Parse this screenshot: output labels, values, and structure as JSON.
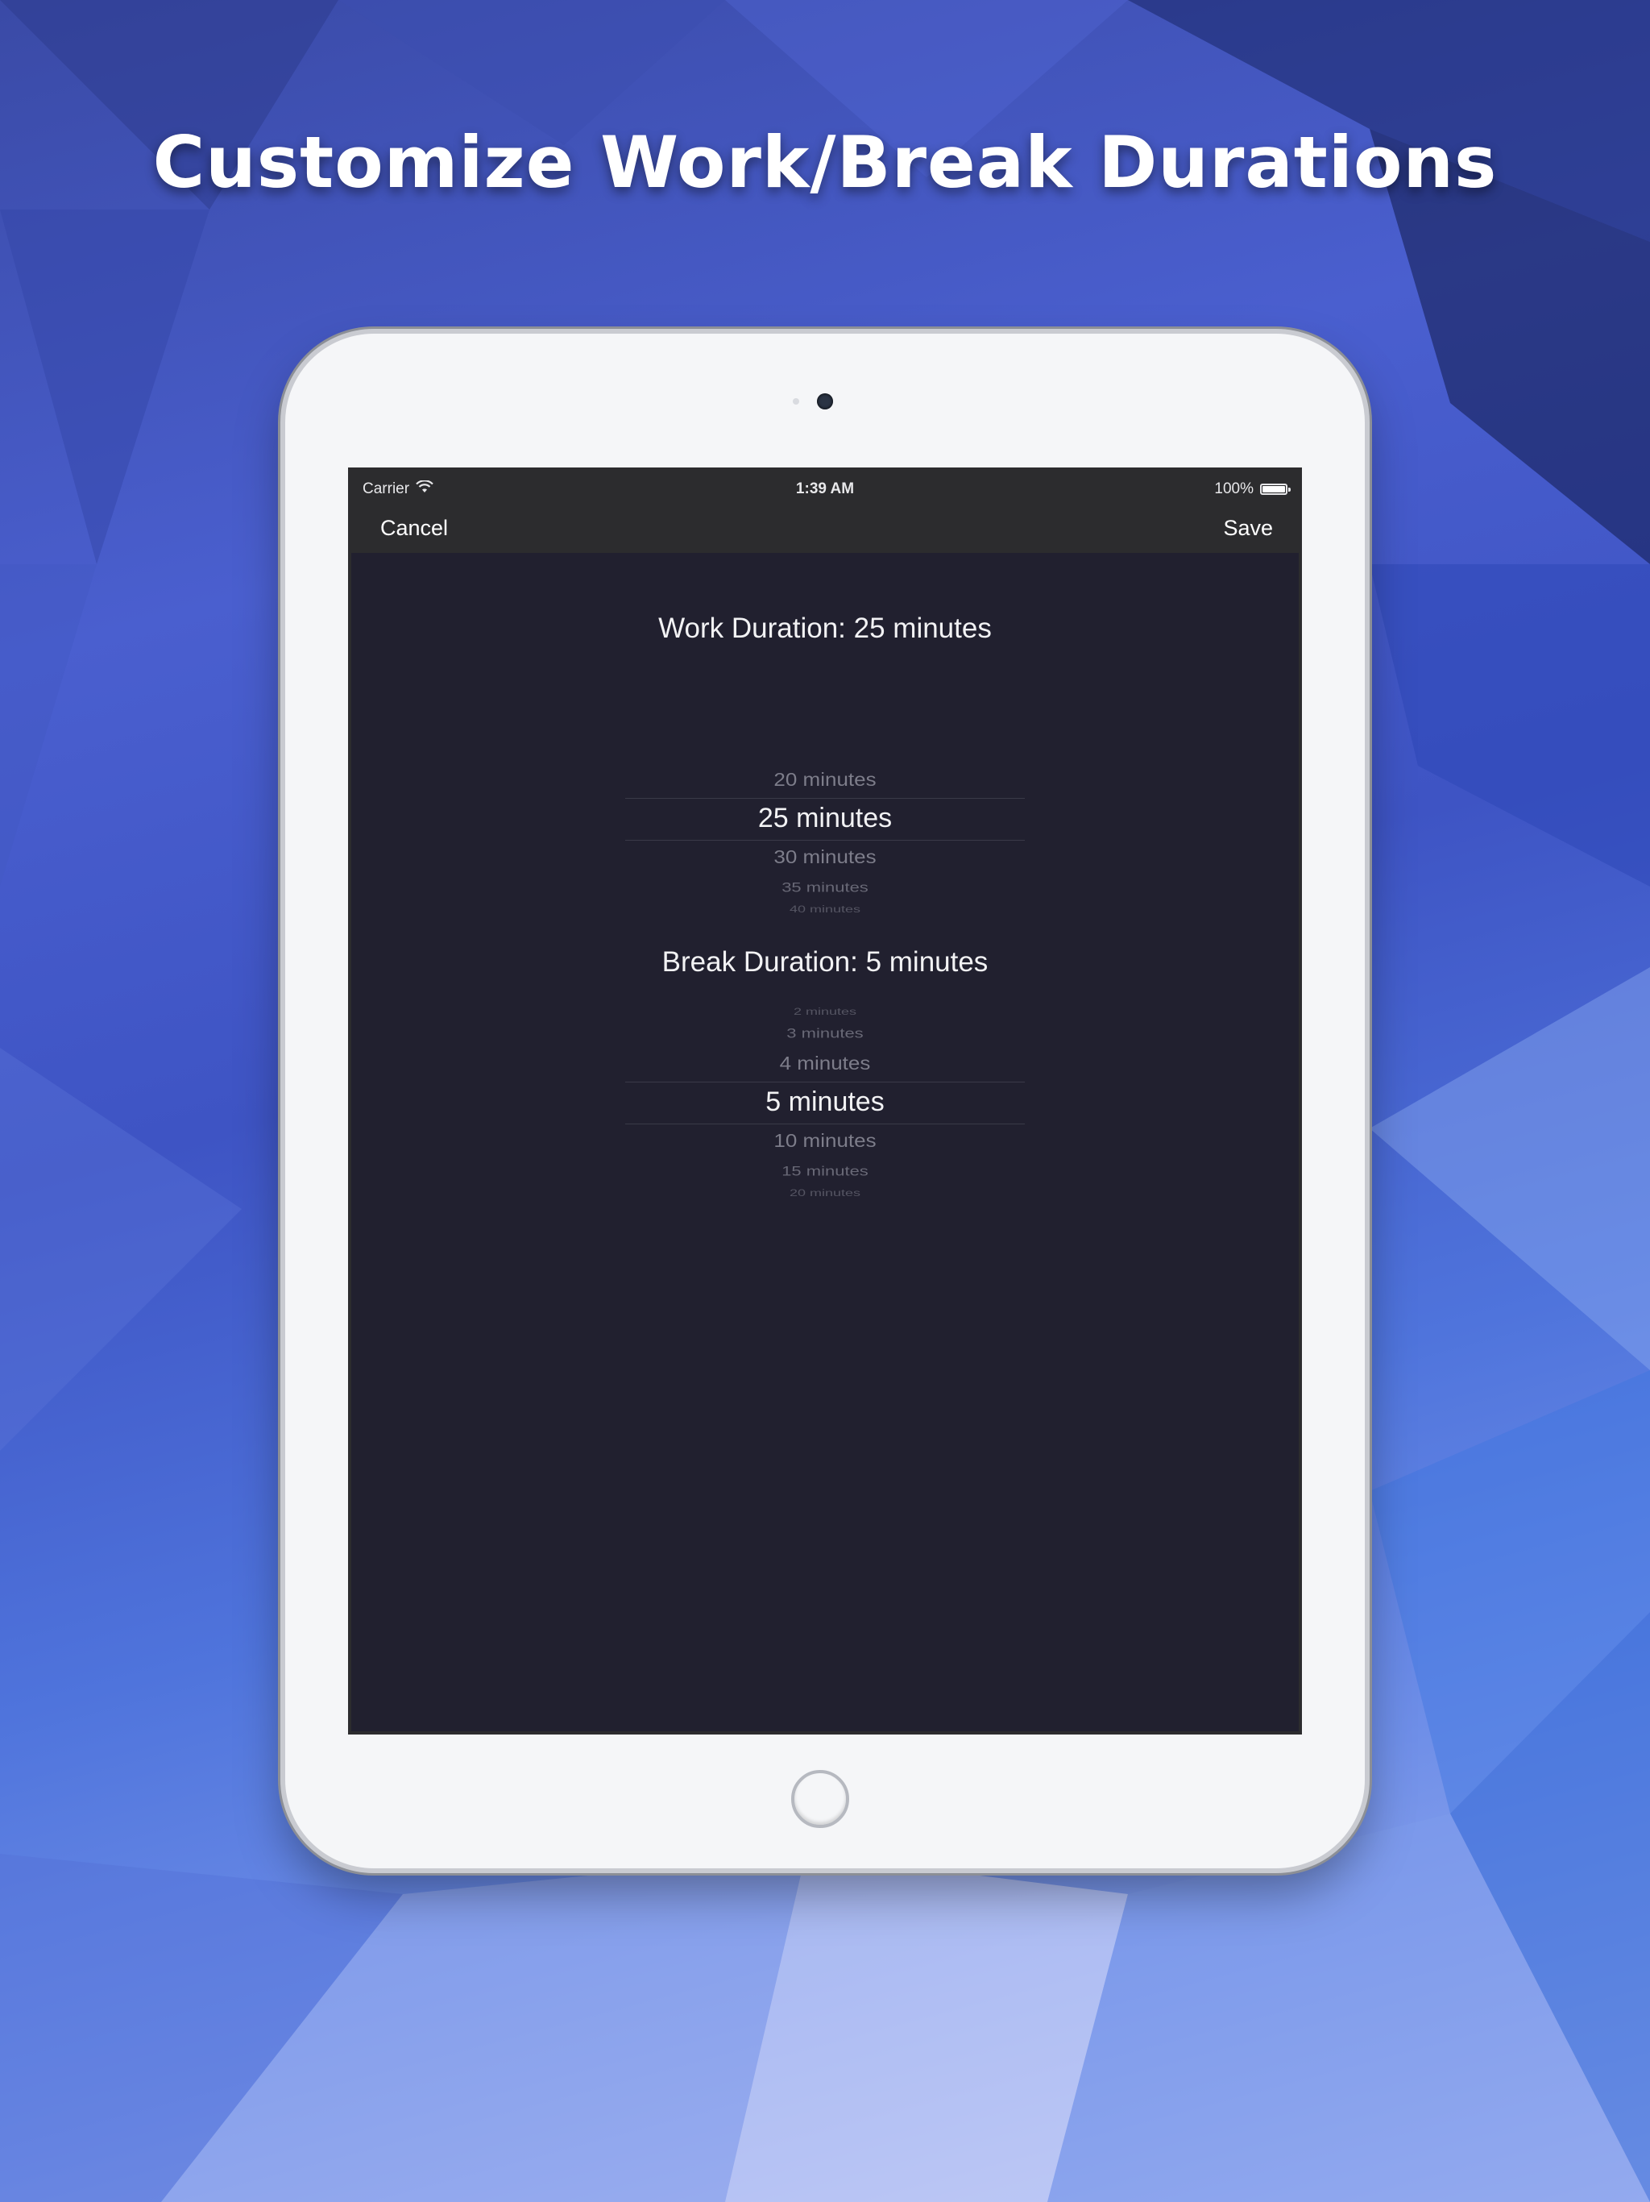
{
  "headline": "Customize Work/Break Durations",
  "status_bar": {
    "carrier": "Carrier",
    "time": "1:39 AM",
    "battery": "100%"
  },
  "nav": {
    "cancel_label": "Cancel",
    "save_label": "Save"
  },
  "work": {
    "title": "Work Duration: 25 minutes",
    "options": [
      "20 minutes",
      "25 minutes",
      "30 minutes",
      "35 minutes",
      "40 minutes"
    ],
    "selected": "25 minutes"
  },
  "break": {
    "title": "Break Duration: 5 minutes",
    "options": [
      "2 minutes",
      "3 minutes",
      "4 minutes",
      "5 minutes",
      "10 minutes",
      "15 minutes",
      "20 minutes"
    ],
    "selected": "5 minutes"
  },
  "colors": {
    "screen_bg": "#21202f",
    "bar_bg": "#2c2c2e",
    "device_body": "#f5f6f8",
    "text_selected": "#f2f2f4",
    "text_dim": "#7d7d8a"
  }
}
